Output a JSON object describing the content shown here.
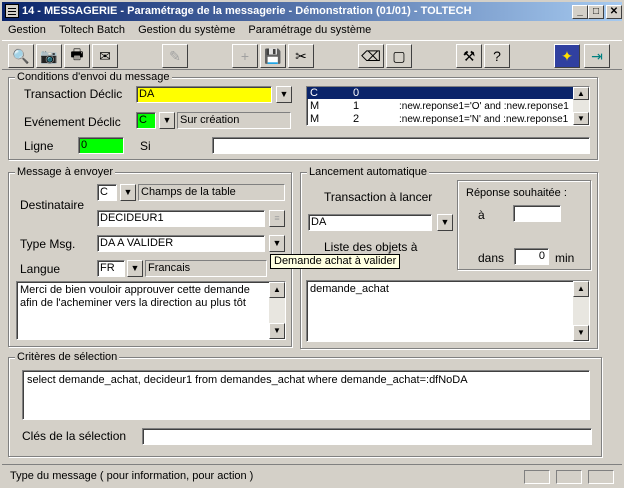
{
  "window": {
    "title": "14 - MESSAGERIE - Paramétrage de la messagerie - Démonstration (01/01) - TOLTECH"
  },
  "menu": [
    "Gestion",
    "Toltech Batch",
    "Gestion du système",
    "Paramétrage du système"
  ],
  "conditions": {
    "title": "Conditions d'envoi du message",
    "transaction_label": "Transaction Déclic",
    "transaction_value": "DA",
    "evenement_label": "Evénement Déclic",
    "evenement_code": "C",
    "evenement_desc": "Sur création",
    "ligne_label": "Ligne",
    "ligne_value": "0",
    "si_label": "Si",
    "si_value": "",
    "list": [
      {
        "c1": "C",
        "c2": "0",
        "c3": ""
      },
      {
        "c1": "M",
        "c2": "1",
        "c3": ":new.reponse1='O'  and :new.reponse1"
      },
      {
        "c1": "M",
        "c2": "2",
        "c3": ":new.reponse1='N'  and :new.reponse1"
      }
    ]
  },
  "message": {
    "title": "Message à envoyer",
    "destinataire_label": "Destinataire",
    "dest_code": "C",
    "dest_desc": "Champs de la table",
    "dest_value": "DECIDEUR1",
    "type_label": "Type Msg.",
    "type_value": "DA A VALIDER",
    "langue_label": "Langue",
    "langue_code": "FR",
    "langue_desc": "Francais",
    "body": "Merci de bien vouloir approuver cette demande afin de l'acheminer vers la direction au plus tôt"
  },
  "tooltip": "Demande achat à valider",
  "lancement": {
    "title": "Lancement automatique",
    "transaction_label": "Transaction à lancer",
    "transaction_value": "DA",
    "liste_label": "Liste des objets à",
    "objets": "demande_achat",
    "reponse_label": "Réponse souhaitée :",
    "a_label": "à",
    "a_value": "",
    "dans_label": "dans",
    "dans_value": "0",
    "min_label": "min"
  },
  "criteres": {
    "title": "Critères de sélection",
    "sql": "select demande_achat, decideur1 from demandes_achat where demande_achat=:dfNoDA",
    "cles_label": "Clés de la sélection",
    "cles_value": ""
  },
  "status": {
    "text": "Type du message ( pour information, pour action )"
  },
  "colors": {
    "title_start": "#0a246a",
    "title_end": "#a6caf0",
    "yellow_field": "#ffff00",
    "green_field": "#00ff00",
    "selected_row": "#0a246a"
  }
}
